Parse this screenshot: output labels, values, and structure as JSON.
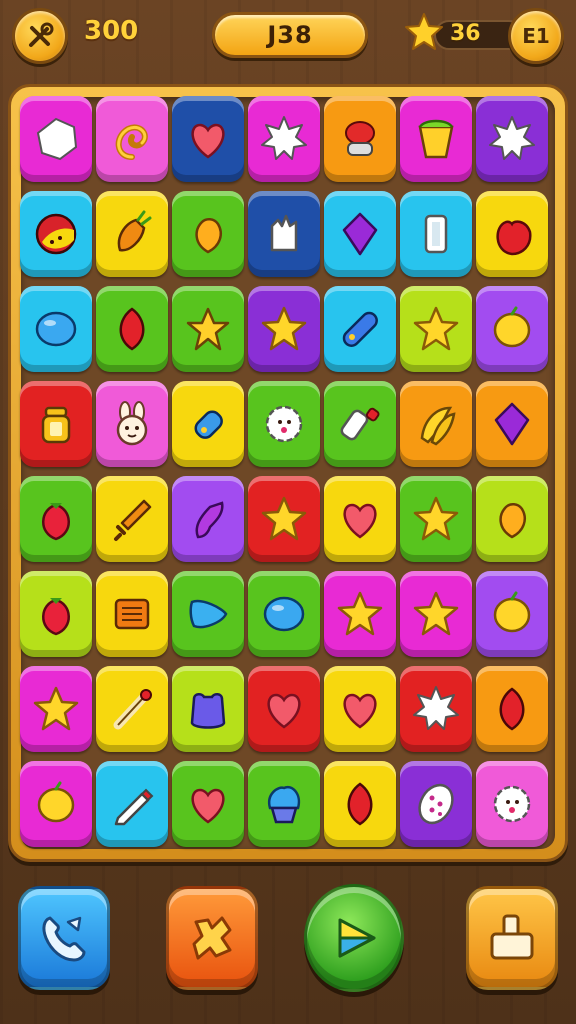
{
  "hud": {
    "score": "300",
    "moves": "J38",
    "stars": "36",
    "level": "E1",
    "settings_icon": "tools-icon",
    "star_icon": "star-icon"
  },
  "colors": {
    "magenta": "#e82ad4",
    "pink": "#f05ad8",
    "navy": "#1f4fa8",
    "orange": "#f79a12",
    "purple": "#8a2fd6",
    "cyan": "#28c4ee",
    "yellow": "#f7d80e",
    "green": "#58c41e",
    "red": "#e22222",
    "lime": "#b6e01a",
    "violet": "#a24cf0"
  },
  "board": {
    "rows": [
      [
        {
          "bg": "magenta",
          "icon": "hexagon"
        },
        {
          "bg": "pink",
          "icon": "swirl"
        },
        {
          "bg": "navy",
          "icon": "heart"
        },
        {
          "bg": "magenta",
          "icon": "burst"
        },
        {
          "bg": "orange",
          "icon": "button"
        },
        {
          "bg": "magenta",
          "icon": "cup"
        },
        {
          "bg": "purple",
          "icon": "burst"
        }
      ],
      [
        {
          "bg": "cyan",
          "icon": "ball"
        },
        {
          "bg": "yellow",
          "icon": "carrot"
        },
        {
          "bg": "green",
          "icon": "drop"
        },
        {
          "bg": "navy",
          "icon": "glove"
        },
        {
          "bg": "cyan",
          "icon": "diamond"
        },
        {
          "bg": "cyan",
          "icon": "block"
        },
        {
          "bg": "yellow",
          "icon": "apple"
        }
      ],
      [
        {
          "bg": "cyan",
          "icon": "oval"
        },
        {
          "bg": "green",
          "icon": "leaf"
        },
        {
          "bg": "green",
          "icon": "star-bolt"
        },
        {
          "bg": "purple",
          "icon": "star"
        },
        {
          "bg": "cyan",
          "icon": "capsule"
        },
        {
          "bg": "lime",
          "icon": "star"
        },
        {
          "bg": "violet",
          "icon": "lemon"
        }
      ],
      [
        {
          "bg": "red",
          "icon": "jar"
        },
        {
          "bg": "pink",
          "icon": "bunny"
        },
        {
          "bg": "yellow",
          "icon": "can"
        },
        {
          "bg": "green",
          "icon": "flower"
        },
        {
          "bg": "green",
          "icon": "bottle"
        },
        {
          "bg": "orange",
          "icon": "banana"
        },
        {
          "bg": "orange",
          "icon": "diamond"
        }
      ],
      [
        {
          "bg": "green",
          "icon": "berry"
        },
        {
          "bg": "yellow",
          "icon": "sword"
        },
        {
          "bg": "violet",
          "icon": "boot"
        },
        {
          "bg": "red",
          "icon": "star"
        },
        {
          "bg": "yellow",
          "icon": "heart"
        },
        {
          "bg": "green",
          "icon": "star"
        },
        {
          "bg": "lime",
          "icon": "drop"
        }
      ],
      [
        {
          "bg": "lime",
          "icon": "berry"
        },
        {
          "bg": "yellow",
          "icon": "box"
        },
        {
          "bg": "green",
          "icon": "triangle"
        },
        {
          "bg": "green",
          "icon": "oval"
        },
        {
          "bg": "magenta",
          "icon": "star"
        },
        {
          "bg": "magenta",
          "icon": "star"
        },
        {
          "bg": "violet",
          "icon": "lemon"
        }
      ],
      [
        {
          "bg": "magenta",
          "icon": "star"
        },
        {
          "bg": "yellow",
          "icon": "brush"
        },
        {
          "bg": "lime",
          "icon": "bag"
        },
        {
          "bg": "red",
          "icon": "heart"
        },
        {
          "bg": "yellow",
          "icon": "heart"
        },
        {
          "bg": "red",
          "icon": "burst"
        },
        {
          "bg": "orange",
          "icon": "leaf"
        }
      ],
      [
        {
          "bg": "magenta",
          "icon": "lemon"
        },
        {
          "bg": "cyan",
          "icon": "pencil"
        },
        {
          "bg": "green",
          "icon": "heart"
        },
        {
          "bg": "green",
          "icon": "cupcake"
        },
        {
          "bg": "yellow",
          "icon": "leaf"
        },
        {
          "bg": "purple",
          "icon": "egg"
        },
        {
          "bg": "pink",
          "icon": "flower"
        }
      ]
    ]
  },
  "controls": [
    {
      "name": "phone-button",
      "icon": "phone-icon"
    },
    {
      "name": "shuffle-button",
      "icon": "puzzle-icon"
    },
    {
      "name": "play-button",
      "icon": "play-icon"
    },
    {
      "name": "lock-button",
      "icon": "lock-icon"
    }
  ]
}
